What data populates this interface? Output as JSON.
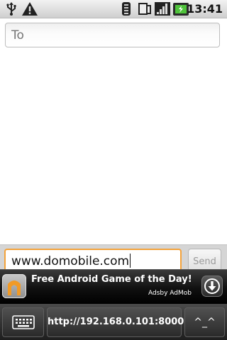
{
  "status_bar": {
    "time": "13:41",
    "icons": [
      "usb-icon",
      "warning-icon",
      "wifi-icon",
      "sim-icon",
      "signal-icon",
      "battery-icon"
    ]
  },
  "recipient_field": {
    "placeholder": "To",
    "value": ""
  },
  "compose": {
    "message_value": "www.domobile.com",
    "send_label": "Send"
  },
  "ad": {
    "title": "Free Android Game of the Day!",
    "attribution": "Adsby AdMob",
    "icons": [
      "game-app-icon",
      "download-icon"
    ]
  },
  "bottom_bar": {
    "keyboard_icon": "keyboard-icon",
    "url_label": "http://192.168.0.101:8000",
    "extra_label": "^_^"
  }
}
